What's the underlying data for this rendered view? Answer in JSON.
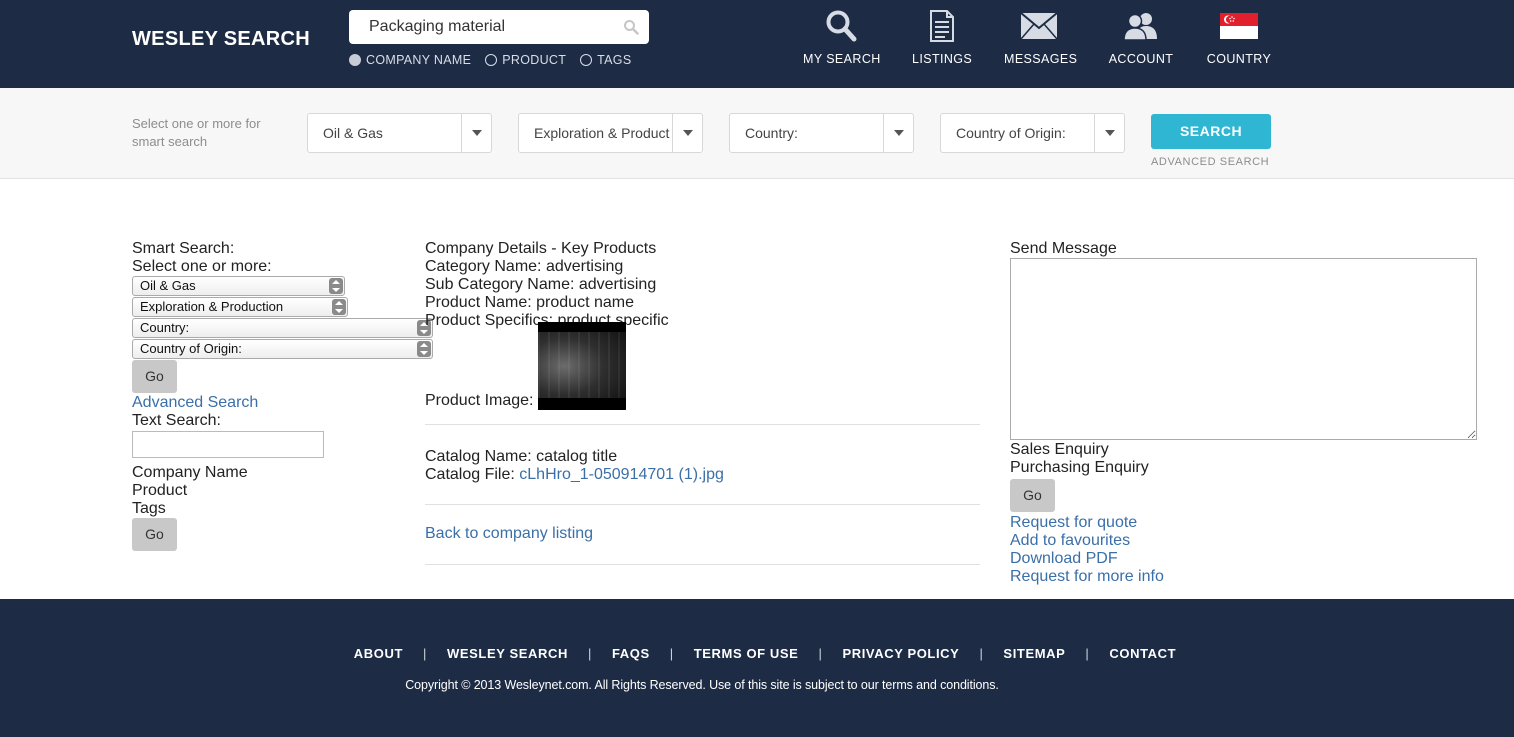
{
  "header": {
    "logo": "WESLEY SEARCH",
    "search_value": "Packaging material",
    "search_types": [
      {
        "label": "COMPANY NAME",
        "checked": true
      },
      {
        "label": "PRODUCT",
        "checked": false
      },
      {
        "label": "TAGS",
        "checked": false
      }
    ],
    "nav": [
      {
        "label": "MY SEARCH",
        "icon": "magnifier-icon"
      },
      {
        "label": "LISTINGS",
        "icon": "document-list-icon"
      },
      {
        "label": "MESSAGES",
        "icon": "envelope-icon"
      },
      {
        "label": "ACCOUNT",
        "icon": "users-icon"
      },
      {
        "label": "COUNTRY",
        "icon": "singapore-flag-icon"
      }
    ]
  },
  "smartbar": {
    "hint": "Select one or more for smart search",
    "dropdowns": [
      "Oil & Gas",
      "Exploration & Production",
      "Country:",
      "Country of Origin:"
    ],
    "search_button": "SEARCH",
    "advanced_link": "ADVANCED SEARCH"
  },
  "left": {
    "title": "Smart Search:",
    "subtitle": "Select one or more:",
    "selects": [
      "Oil & Gas",
      "Exploration & Production",
      "Country:",
      "Country of Origin:"
    ],
    "go": "Go",
    "advanced": "Advanced Search",
    "text_search_label": "Text Search:",
    "text_search_value": "",
    "options": [
      "Company Name",
      "Product",
      "Tags"
    ],
    "go2": "Go"
  },
  "middle": {
    "heading": "Company Details - Key Products",
    "category": "Category Name: advertising",
    "subcategory": "Sub Category Name: advertising",
    "product_name": "Product Name: product name",
    "product_specifics": "Product Specifics: product specific",
    "image_label": "Product Image:",
    "catalog_name": "Catalog Name: catalog title",
    "catalog_file_label": "Catalog File:",
    "catalog_file": "cLhHro_1-050914701 (1).jpg",
    "back_link": "Back to company listing"
  },
  "right": {
    "title": "Send Message",
    "message_value": "",
    "enquiry_types": [
      "Sales Enquiry",
      "Purchasing Enquiry"
    ],
    "go": "Go",
    "links": [
      "Request for quote",
      "Add to favourites",
      "Download PDF",
      "Request for more info"
    ]
  },
  "footer": {
    "links": [
      "ABOUT",
      "WESLEY SEARCH",
      "FAQS",
      "TERMS OF USE",
      "PRIVACY POLICY",
      "SITEMAP",
      "CONTACT"
    ],
    "copyright": "Copyright © 2013 Wesleynet.com. All Rights Reserved. Use of this site is subject to our terms and conditions."
  },
  "colors": {
    "header_bg": "#1d2b45",
    "accent": "#2fb6d2",
    "link": "#3a6fa8"
  }
}
